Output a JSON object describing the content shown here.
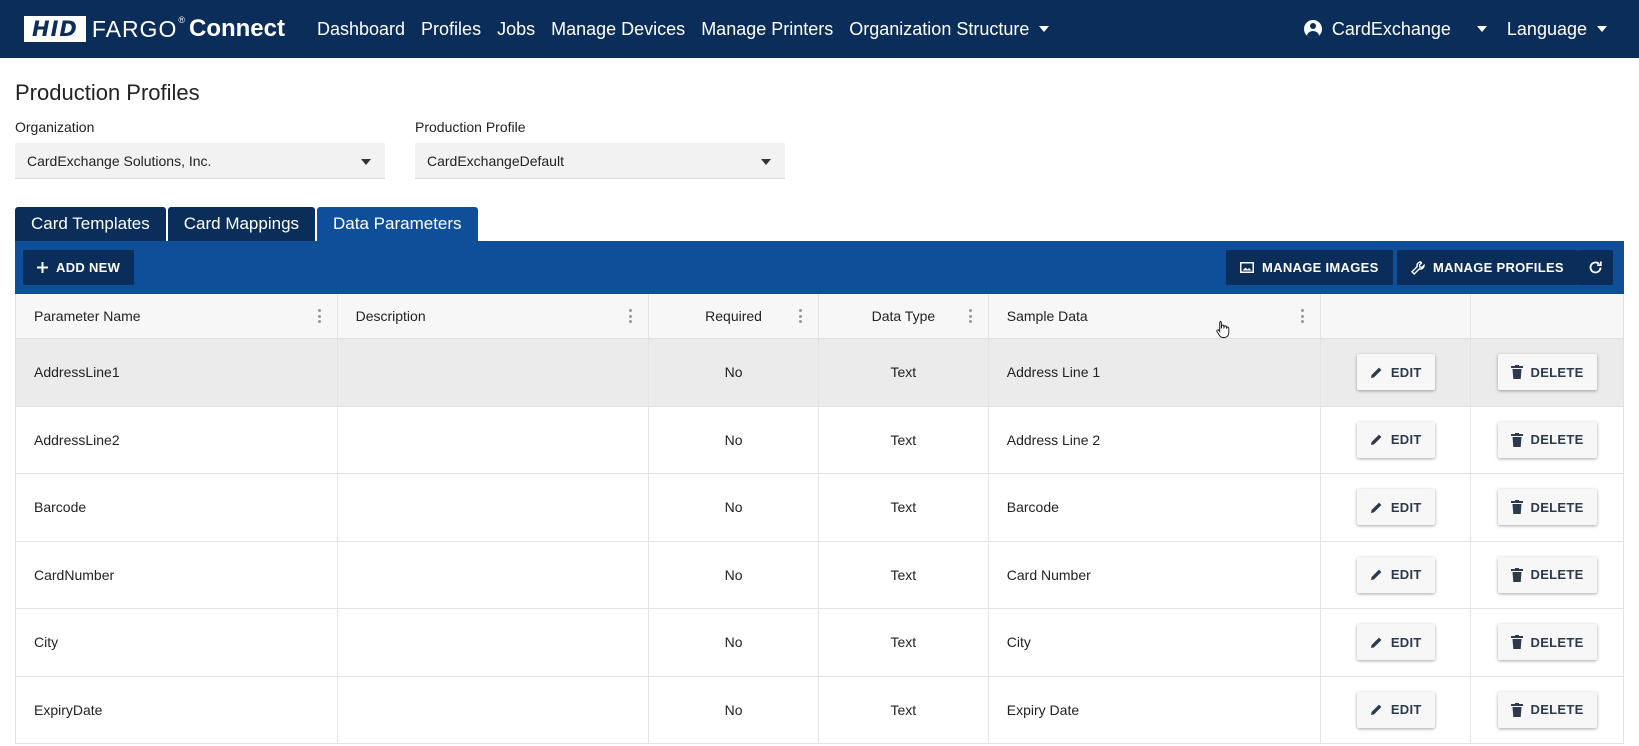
{
  "brand": {
    "hid": "HID",
    "fargo": "FARGO",
    "reg": "®",
    "connect": "Connect"
  },
  "nav": {
    "items": [
      {
        "label": "Dashboard"
      },
      {
        "label": "Profiles"
      },
      {
        "label": "Jobs"
      },
      {
        "label": "Manage Devices"
      },
      {
        "label": "Manage Printers"
      },
      {
        "label": "Organization Structure"
      }
    ],
    "user": "CardExchange",
    "language": "Language"
  },
  "page": {
    "title": "Production Profiles",
    "organization_label": "Organization",
    "organization_value": "CardExchange Solutions, Inc.",
    "profile_label": "Production Profile",
    "profile_value": "CardExchangeDefault"
  },
  "tabs": [
    {
      "label": "Card Templates"
    },
    {
      "label": "Card Mappings"
    },
    {
      "label": "Data Parameters",
      "active": true
    }
  ],
  "toolbar": {
    "add_new": "ADD NEW",
    "manage_images": "MANAGE IMAGES",
    "manage_profiles": "MANAGE PROFILES"
  },
  "table": {
    "columns": [
      "Parameter Name",
      "Description",
      "Required",
      "Data Type",
      "Sample Data"
    ],
    "edit_label": "EDIT",
    "delete_label": "DELETE",
    "rows": [
      {
        "name": "AddressLine1",
        "description": "",
        "required": "No",
        "type": "Text",
        "sample": "Address Line 1"
      },
      {
        "name": "AddressLine2",
        "description": "",
        "required": "No",
        "type": "Text",
        "sample": "Address Line 2"
      },
      {
        "name": "Barcode",
        "description": "",
        "required": "No",
        "type": "Text",
        "sample": "Barcode"
      },
      {
        "name": "CardNumber",
        "description": "",
        "required": "No",
        "type": "Text",
        "sample": "Card Number"
      },
      {
        "name": "City",
        "description": "",
        "required": "No",
        "type": "Text",
        "sample": "City"
      },
      {
        "name": "ExpiryDate",
        "description": "",
        "required": "No",
        "type": "Text",
        "sample": "Expiry Date"
      }
    ]
  },
  "colors": {
    "nav_bg": "#0b2d59",
    "toolbar_bg": "#0f4f99",
    "active_tab": "#0f4f99"
  },
  "icons": {
    "add": "plus-icon",
    "images": "image-icon",
    "profiles": "wrench-icon",
    "refresh": "refresh-icon",
    "edit": "pencil-icon",
    "delete": "trash-icon"
  }
}
